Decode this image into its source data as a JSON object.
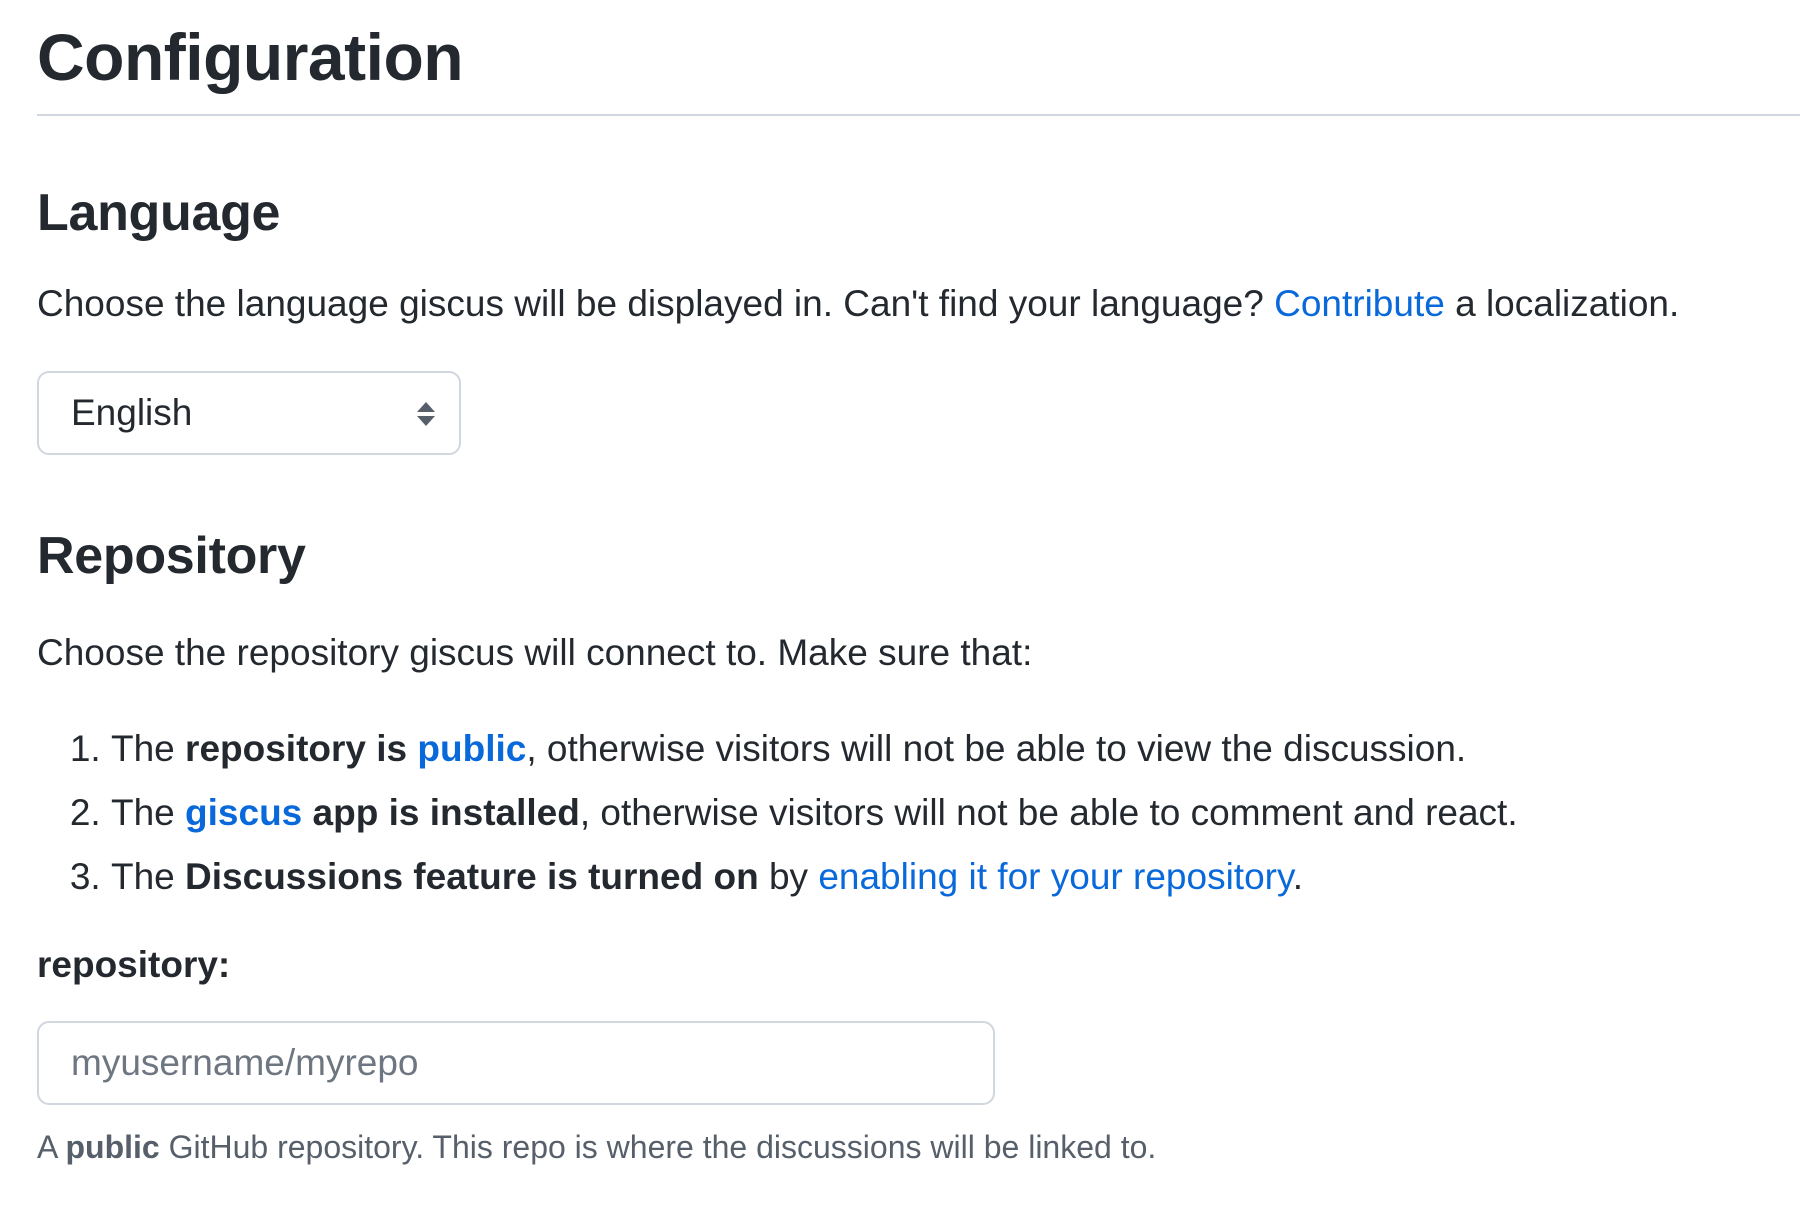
{
  "title": "Configuration",
  "language": {
    "heading": "Language",
    "description_before": "Choose the language giscus will be displayed in. Can't find your language? ",
    "description_link": "Contribute",
    "description_after": " a localization.",
    "select_value": "English"
  },
  "repository": {
    "heading": "Repository",
    "description": "Choose the repository giscus will connect to. Make sure that:",
    "items": [
      {
        "t1": "The ",
        "b1": "repository is ",
        "link": "public",
        "t2": ", otherwise visitors will not be able to view the discussion."
      },
      {
        "t1": "The ",
        "link": "giscus",
        "b1": " app is installed",
        "t2": ", otherwise visitors will not be able to comment and react."
      },
      {
        "t1": "The ",
        "b1": "Discussions feature is turned on",
        "t2": " by ",
        "link": "enabling it for your repository",
        "t3": "."
      }
    ],
    "field_label": "repository:",
    "field_placeholder": "myusername/myrepo",
    "field_value": "",
    "hint_before": "A ",
    "hint_bold": "public",
    "hint_after": " GitHub repository. This repo is where the discussions will be linked to."
  },
  "colors": {
    "text": "#24292f",
    "link": "#0969da",
    "muted": "#57606a",
    "border": "#d0d7de"
  },
  "icons": {
    "select": "up-down-arrows-icon"
  }
}
